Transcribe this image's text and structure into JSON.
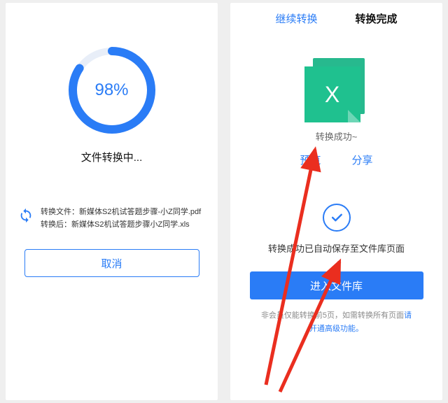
{
  "left": {
    "progress_pct": "98%",
    "status": "文件转换中...",
    "file_in_label": "转换文件：",
    "file_in": "新媒体S2机试答题步骤-小Z同学.pdf",
    "file_out_label": "转换后：",
    "file_out": "新媒体S2机试答题步骤小Z同学.xls",
    "cancel": "取消"
  },
  "right": {
    "tab_continue": "继续转换",
    "tab_done": "转换完成",
    "success": "转换成功~",
    "preview": "预览",
    "share": "分享",
    "saved": "转换成功已自动保存至文件库页面",
    "go_library": "进入文件库",
    "hint_prefix": "非会员仅能转换前5页，如需转换所有页面",
    "hint_link": "请开通高级功能。"
  },
  "colors": {
    "primary": "#2a7cf6",
    "green": "#1fc18f",
    "arrow": "#ea2e1f"
  },
  "icons": {
    "sync": "sync-icon",
    "xls": "xls-file-icon",
    "check": "check-icon"
  }
}
